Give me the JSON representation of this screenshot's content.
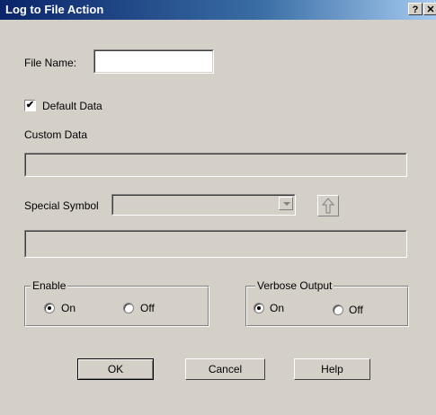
{
  "window": {
    "title": "Log to File Action",
    "help_glyph": "?",
    "close_glyph": "✕"
  },
  "file_name": {
    "label": "File Name:",
    "value": ""
  },
  "default_data": {
    "label": "Default Data",
    "checked": true,
    "check_glyph": "✔"
  },
  "custom_data": {
    "label": "Custom Data",
    "value": ""
  },
  "special_symbol": {
    "label": "Special Symbol",
    "selected": ""
  },
  "enable": {
    "legend": "Enable",
    "options": [
      "On",
      "Off"
    ],
    "selected": "On"
  },
  "verbose_output": {
    "legend": "Verbose Output",
    "options": [
      "On",
      "Off"
    ],
    "selected": "On"
  },
  "buttons": {
    "ok": "OK",
    "cancel": "Cancel",
    "help": "Help"
  }
}
